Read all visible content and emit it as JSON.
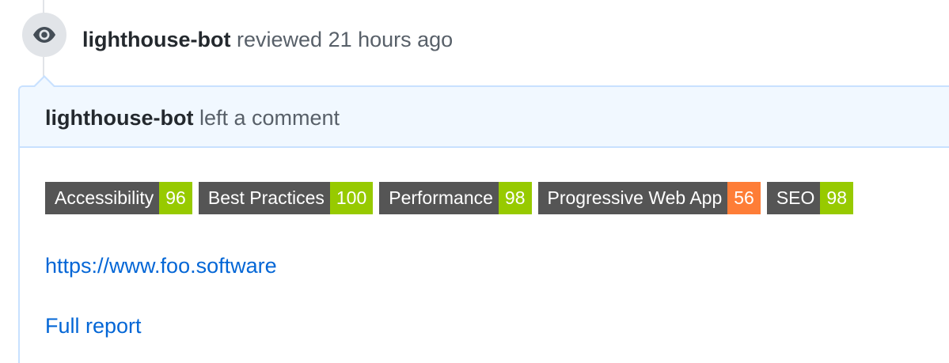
{
  "review": {
    "author": "lighthouse-bot",
    "action": "reviewed",
    "time": "21 hours ago",
    "icon": "eye-icon"
  },
  "comment": {
    "author": "lighthouse-bot",
    "action": "left a comment",
    "badges": [
      {
        "label": "Accessibility",
        "score": "96",
        "color": "#97ca00"
      },
      {
        "label": "Best Practices",
        "score": "100",
        "color": "#97ca00"
      },
      {
        "label": "Performance",
        "score": "98",
        "color": "#97ca00"
      },
      {
        "label": "Progressive Web App",
        "score": "56",
        "color": "#fe7d37"
      },
      {
        "label": "SEO",
        "score": "98",
        "color": "#97ca00"
      }
    ],
    "site_url": "https://www.foo.software",
    "report_link": "Full report"
  },
  "colors": {
    "link": "#0366d6",
    "badge_label_bg": "#555555",
    "header_bg": "#f1f8ff",
    "border": "#c8e1ff"
  }
}
